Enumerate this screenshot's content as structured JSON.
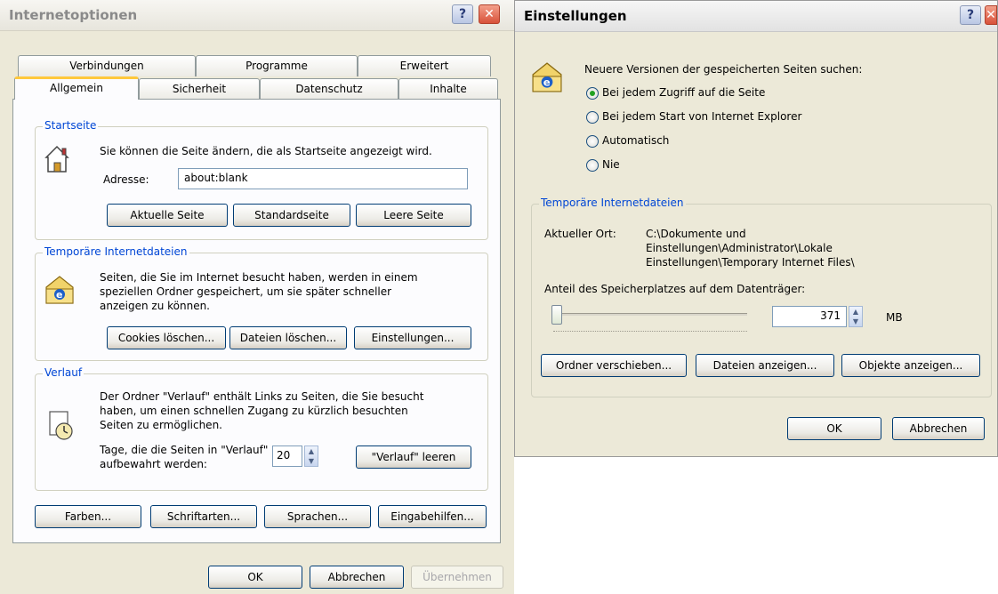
{
  "internet_options": {
    "title": "Internetoptionen",
    "tabs_row1": [
      "Verbindungen",
      "Programme",
      "Erweitert"
    ],
    "tabs_row2": [
      "Allgemein",
      "Sicherheit",
      "Datenschutz",
      "Inhalte"
    ],
    "startseite": {
      "label": "Startseite",
      "description": "Sie können die Seite ändern, die als Startseite angezeigt wird.",
      "address_label": "Adresse:",
      "address_value": "about:blank",
      "buttons": [
        "Aktuelle Seite",
        "Standardseite",
        "Leere Seite"
      ]
    },
    "temp_files": {
      "label": "Temporäre Internetdateien",
      "description_lines": [
        "Seiten, die Sie im Internet besucht haben, werden in einem",
        "speziellen Ordner gespeichert, um sie später schneller",
        "anzeigen zu können."
      ],
      "buttons": [
        "Cookies löschen...",
        "Dateien löschen...",
        "Einstellungen..."
      ]
    },
    "verlauf": {
      "label": "Verlauf",
      "description_lines": [
        "Der Ordner \"Verlauf\" enthält Links zu Seiten, die Sie besucht",
        "haben, um einen schnellen Zugang zu kürzlich besuchten",
        "Seiten zu ermöglichen."
      ],
      "days_label_lines": [
        "Tage, die die Seiten in \"Verlauf\"",
        "aufbewahrt werden:"
      ],
      "days_value": "20",
      "clear_button": "\"Verlauf\" leeren"
    },
    "bottom_buttons": [
      "Farben...",
      "Schriftarten...",
      "Sprachen...",
      "Eingabehilfen..."
    ],
    "dialog_buttons": {
      "ok": "OK",
      "cancel": "Abbrechen",
      "apply": "Übernehmen"
    }
  },
  "einstellungen": {
    "title": "Einstellungen",
    "check_label": "Neuere Versionen der gespeicherten Seiten suchen:",
    "radio_options": [
      "Bei jedem Zugriff auf die Seite",
      "Bei jedem Start von Internet Explorer",
      "Automatisch",
      "Nie"
    ],
    "selected_option": "Bei jedem Zugriff auf die Seite",
    "temp_group_label": "Temporäre Internetdateien",
    "location_label": "Aktueller Ort:",
    "location_lines": [
      "C:\\Dokumente und",
      "Einstellungen\\Administrator\\Lokale",
      "Einstellungen\\Temporary Internet Files\\"
    ],
    "space_label": "Anteil des Speicherplatzes auf dem Datenträger:",
    "space_value": "371",
    "space_unit": "MB",
    "group_buttons": [
      "Ordner verschieben...",
      "Dateien anzeigen...",
      "Objekte anzeigen..."
    ],
    "dialog_buttons": {
      "ok": "OK",
      "cancel": "Abbrechen"
    }
  },
  "colors": {
    "group_label": "#0046d5",
    "window_bg": "#ece9d8",
    "tab_highlight": "#ffc83c"
  }
}
